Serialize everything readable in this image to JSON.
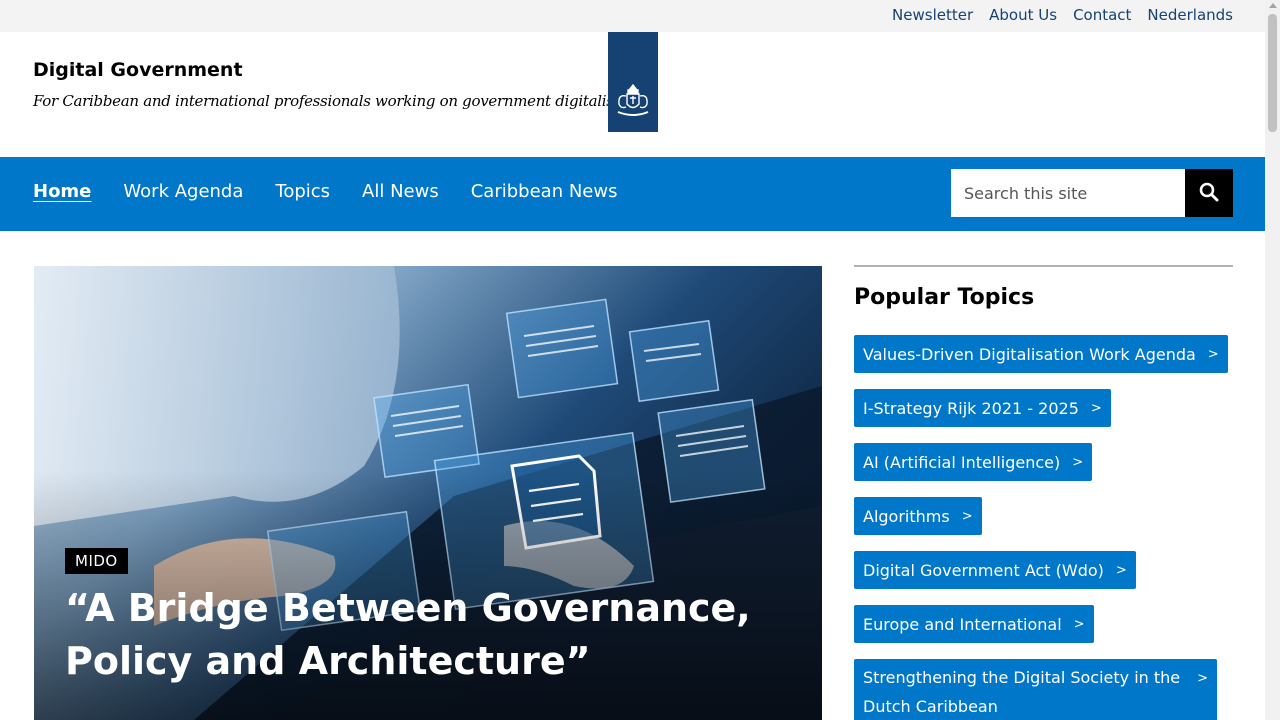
{
  "utility": {
    "links": [
      "Newsletter",
      "About Us",
      "Contact",
      "Nederlands"
    ]
  },
  "header": {
    "title": "Digital Government",
    "tagline": "For Caribbean and international professionals working on government digitalisation",
    "logo_icon": "royal-coat-of-arms-icon"
  },
  "nav": {
    "items": [
      "Home",
      "Work Agenda",
      "Topics",
      "All News",
      "Caribbean News"
    ],
    "active": "Home",
    "search_placeholder": "Search this site",
    "search_icon": "search-icon"
  },
  "hero": {
    "badge": "MIDO",
    "title": "“A Bridge Between Governance, Policy and Architecture”"
  },
  "sidebar": {
    "heading": "Popular Topics",
    "topics": [
      "Values-Driven Digitalisation Work Agenda",
      "I-Strategy Rijk 2021 - 2025",
      "AI (Artificial Intelligence)",
      "Algorithms",
      "Digital Government Act (Wdo)",
      "Europe and International",
      "Strengthening the Digital Society in the Dutch Caribbean"
    ],
    "chevron": ">"
  },
  "colors": {
    "nav_blue": "#0077c8",
    "logo_blue": "#154273",
    "utility_link": "#154273"
  }
}
